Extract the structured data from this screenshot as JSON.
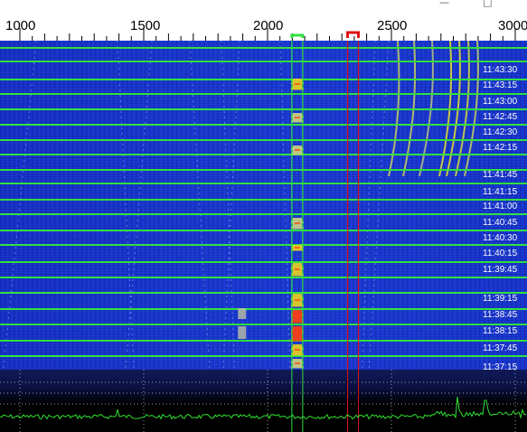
{
  "window": {
    "minimize_label": "—",
    "maximize_label": "□"
  },
  "scale": {
    "unit": "Hz",
    "ticks": [
      {
        "value": 1000,
        "label": "1000"
      },
      {
        "value": 1500,
        "label": "1500"
      },
      {
        "value": 2000,
        "label": "2000"
      },
      {
        "value": 2500,
        "label": "2500"
      },
      {
        "value": 3000,
        "label": "3000"
      }
    ],
    "range": [
      900,
      3050
    ],
    "rx_marker_hz": 2120,
    "tx_marker_hz": 2345
  },
  "waterfall": {
    "time_labels": [
      "11:43:30",
      "11:43:15",
      "11:43:00",
      "11:42:45",
      "11:42:30",
      "11:42:15",
      "11:41:45",
      "11:41:15",
      "11:41:00",
      "11:40:45",
      "11:40:30",
      "11:40:15",
      "11:39:45",
      "11:39:15",
      "11:38:45",
      "11:38:15",
      "11:37:45",
      "11:37:15"
    ],
    "signal_colors": {
      "noise": "#1634cc",
      "weak": "#c8d080",
      "medium": "#e8d020",
      "strong": "#ff4010"
    }
  },
  "colors": {
    "period_line": "#30e040",
    "rx_marker": "#30e040",
    "tx_marker": "#e01010",
    "spectrum_trace": "#30e030"
  }
}
